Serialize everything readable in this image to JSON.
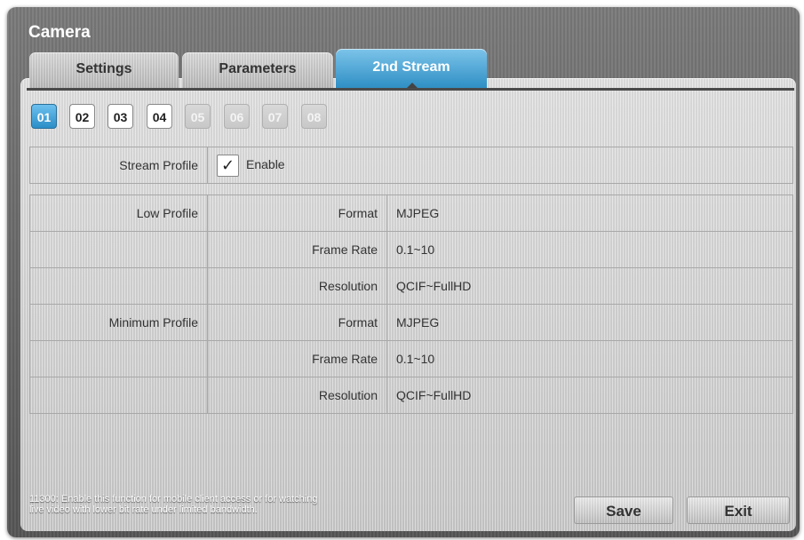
{
  "window": {
    "title": "Camera"
  },
  "tabs": [
    {
      "label": "Settings",
      "active": false
    },
    {
      "label": "Parameters",
      "active": false
    },
    {
      "label": "2nd Stream",
      "active": true
    }
  ],
  "channels": [
    {
      "label": "01",
      "state": "active"
    },
    {
      "label": "02",
      "state": "on"
    },
    {
      "label": "03",
      "state": "on"
    },
    {
      "label": "04",
      "state": "on"
    },
    {
      "label": "05",
      "state": "off"
    },
    {
      "label": "06",
      "state": "off"
    },
    {
      "label": "07",
      "state": "off"
    },
    {
      "label": "08",
      "state": "off"
    }
  ],
  "stream_profile": {
    "label": "Stream Profile",
    "checkbox_label": "Enable",
    "checked": true
  },
  "profiles": [
    {
      "name": "Low Profile",
      "rows": [
        {
          "label": "Format",
          "value": "MJPEG"
        },
        {
          "label": "Frame Rate",
          "value": "0.1~10"
        },
        {
          "label": "Resolution",
          "value": "QCIF~FullHD"
        }
      ]
    },
    {
      "name": "Minimum Profile",
      "rows": [
        {
          "label": "Format",
          "value": "MJPEG"
        },
        {
          "label": "Frame Rate",
          "value": "0.1~10"
        },
        {
          "label": "Resolution",
          "value": "QCIF~FullHD"
        }
      ]
    }
  ],
  "footer": {
    "note_line1": "11300: Enable this function for mobile client access or for watching",
    "note_line2": "live video with lower bit rate under limited bandwidth.",
    "save_label": "Save",
    "exit_label": "Exit"
  },
  "colors": {
    "accent": "#3a9ad0",
    "background": "#cfcfcf",
    "frame": "#666666"
  }
}
